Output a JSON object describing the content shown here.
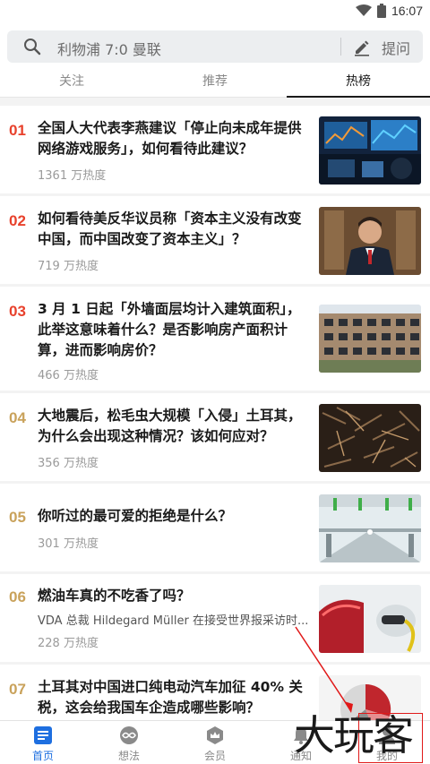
{
  "status_bar": {
    "time": "16:07",
    "wifi_icon": "wifi-icon",
    "battery_icon": "battery-icon"
  },
  "search": {
    "query": "利物浦 7:0 曼联",
    "ask_label": "提问",
    "icon": "search-icon",
    "ask_icon": "pencil-icon"
  },
  "tabs": [
    {
      "label": "关注",
      "active": false
    },
    {
      "label": "推荐",
      "active": false
    },
    {
      "label": "热榜",
      "active": true
    }
  ],
  "hot_list": [
    {
      "rank": "01",
      "title": "全国人大代表李燕建议「停止向未成年提供网络游戏服务」，如何看待此建议？",
      "heat": "1361 万热度"
    },
    {
      "rank": "02",
      "title": "如何看待美反华议员称「资本主义没有改变中国，而中国改变了资本主义」？",
      "heat": "719 万热度"
    },
    {
      "rank": "03",
      "title": "3 月 1 日起「外墙面层均计入建筑面积」，此举这意味着什么？是否影响房产面积计算，进而影响房价？",
      "heat": "466 万热度"
    },
    {
      "rank": "04",
      "title": "大地震后，松毛虫大规模「入侵」土耳其，为什么会出现这种情况？该如何应对？",
      "heat": "356 万热度"
    },
    {
      "rank": "05",
      "title": "你听过的最可爱的拒绝是什么？",
      "heat": "301 万热度"
    },
    {
      "rank": "06",
      "title": "燃油车真的不吃香了吗？",
      "excerpt": "VDA 总裁 Hildegard Müller 在接受世界报采访时...",
      "heat": "228 万热度"
    },
    {
      "rank": "07",
      "title": "土耳其对中国进口纯电动汽车加征 40% 关税，这会给我国车企造成哪些影响？",
      "heat": ""
    }
  ],
  "bottom_nav": [
    {
      "label": "首页",
      "icon": "home-icon",
      "active": true
    },
    {
      "label": "想法",
      "icon": "infinity-icon",
      "active": false
    },
    {
      "label": "会员",
      "icon": "crown-icon",
      "active": false
    },
    {
      "label": "通知",
      "icon": "bell-icon",
      "active": false
    },
    {
      "label": "我的",
      "icon": "user-icon",
      "active": false
    }
  ],
  "watermark": "大玩客",
  "colors": {
    "hot_rank": "#e8412c",
    "warm_rank": "#c9a25b",
    "accent": "#1e6fe0",
    "annotation": "#e01818"
  }
}
